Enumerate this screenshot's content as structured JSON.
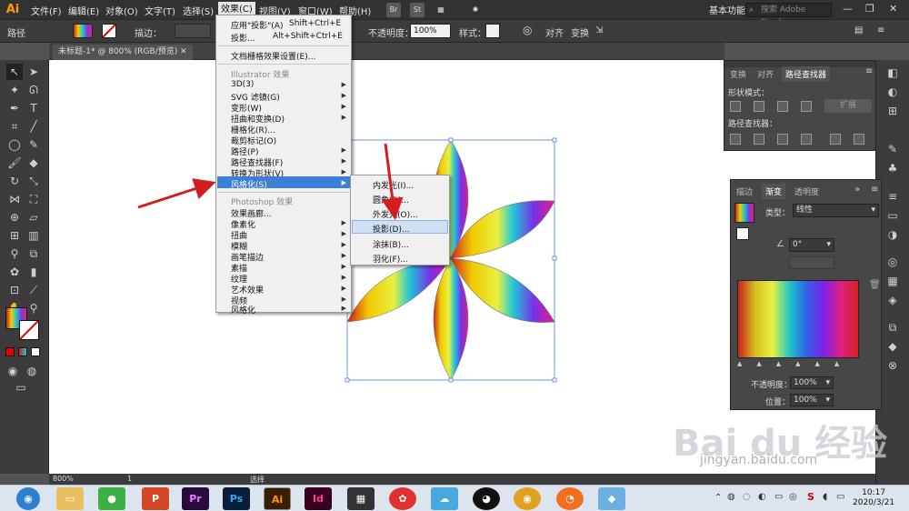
{
  "menubar": {
    "items": [
      "文件(F)",
      "编辑(E)",
      "对象(O)",
      "文字(T)",
      "选择(S)",
      "效果(C)",
      "视图(V)",
      "窗口(W)",
      "帮助(H)"
    ],
    "logo": "Ai",
    "br": "Br",
    "st": "St",
    "workspace": "基本功能",
    "search_placeholder": "搜索 Adobe Stock"
  },
  "controlbar": {
    "label": "路径",
    "stroke_label": "描边：",
    "opacity_label": "不透明度：",
    "opacity_value": "100%",
    "style_label": "样式：",
    "align": "对齐",
    "transform": "变换"
  },
  "document": {
    "tab": "未标题-1* @ 800% (RGB/预览)"
  },
  "status": {
    "zoom": "800%",
    "page": "1",
    "tool": "选择"
  },
  "effect_menu": {
    "apply_last": "应用\"投影\"(A)",
    "apply_last_shortcut": "Shift+Ctrl+E",
    "last_effect": "投影...",
    "last_effect_shortcut": "Alt+Shift+Ctrl+E",
    "raster_settings": "文档栅格效果设置(E)...",
    "illustrator_header": "Illustrator 效果",
    "illustrator_items": [
      "3D(3)",
      "SVG 滤镜(G)",
      "变形(W)",
      "扭曲和变换(D)",
      "栅格化(R)...",
      "裁剪标记(O)",
      "路径(P)",
      "路径查找器(F)",
      "转换为形状(V)",
      "风格化(S)"
    ],
    "photoshop_header": "Photoshop 效果",
    "photoshop_items": [
      "效果画廊...",
      "像素化",
      "扭曲",
      "模糊",
      "画笔描边",
      "素描",
      "纹理",
      "艺术效果",
      "视频",
      "风格化"
    ]
  },
  "stylize_submenu": {
    "items": [
      "内发光(I)...",
      "圆角(R)...",
      "外发光(O)...",
      "投影(D)...",
      "涂抹(B)...",
      "羽化(F)..."
    ]
  },
  "pathfinder_panel": {
    "tabs": [
      "变换",
      "对齐",
      "路径查找器"
    ],
    "shape_modes": "形状模式：",
    "pathfinders": "路径查找器：",
    "expand": "扩展"
  },
  "gradient_panel": {
    "tabs": [
      "描边",
      "渐变",
      "透明度"
    ],
    "type_label": "类型：",
    "type_value": "线性",
    "angle_value": "0°",
    "opacity_label": "不透明度：",
    "opacity_value": "100%",
    "position_label": "位置：",
    "position_value": "100%"
  },
  "taskbar": {
    "time": "10:17",
    "date": "2020/3/21",
    "apps": [
      "Pr",
      "Ps",
      "Ai",
      "Id"
    ]
  },
  "watermark": {
    "brand": "Bai du 经验",
    "url": "jingyan.baidu.com"
  },
  "colors": {
    "accent": "#3f8fd8",
    "menu_highlight": "#3b7fd6",
    "ai_orange": "#ff9a00"
  }
}
